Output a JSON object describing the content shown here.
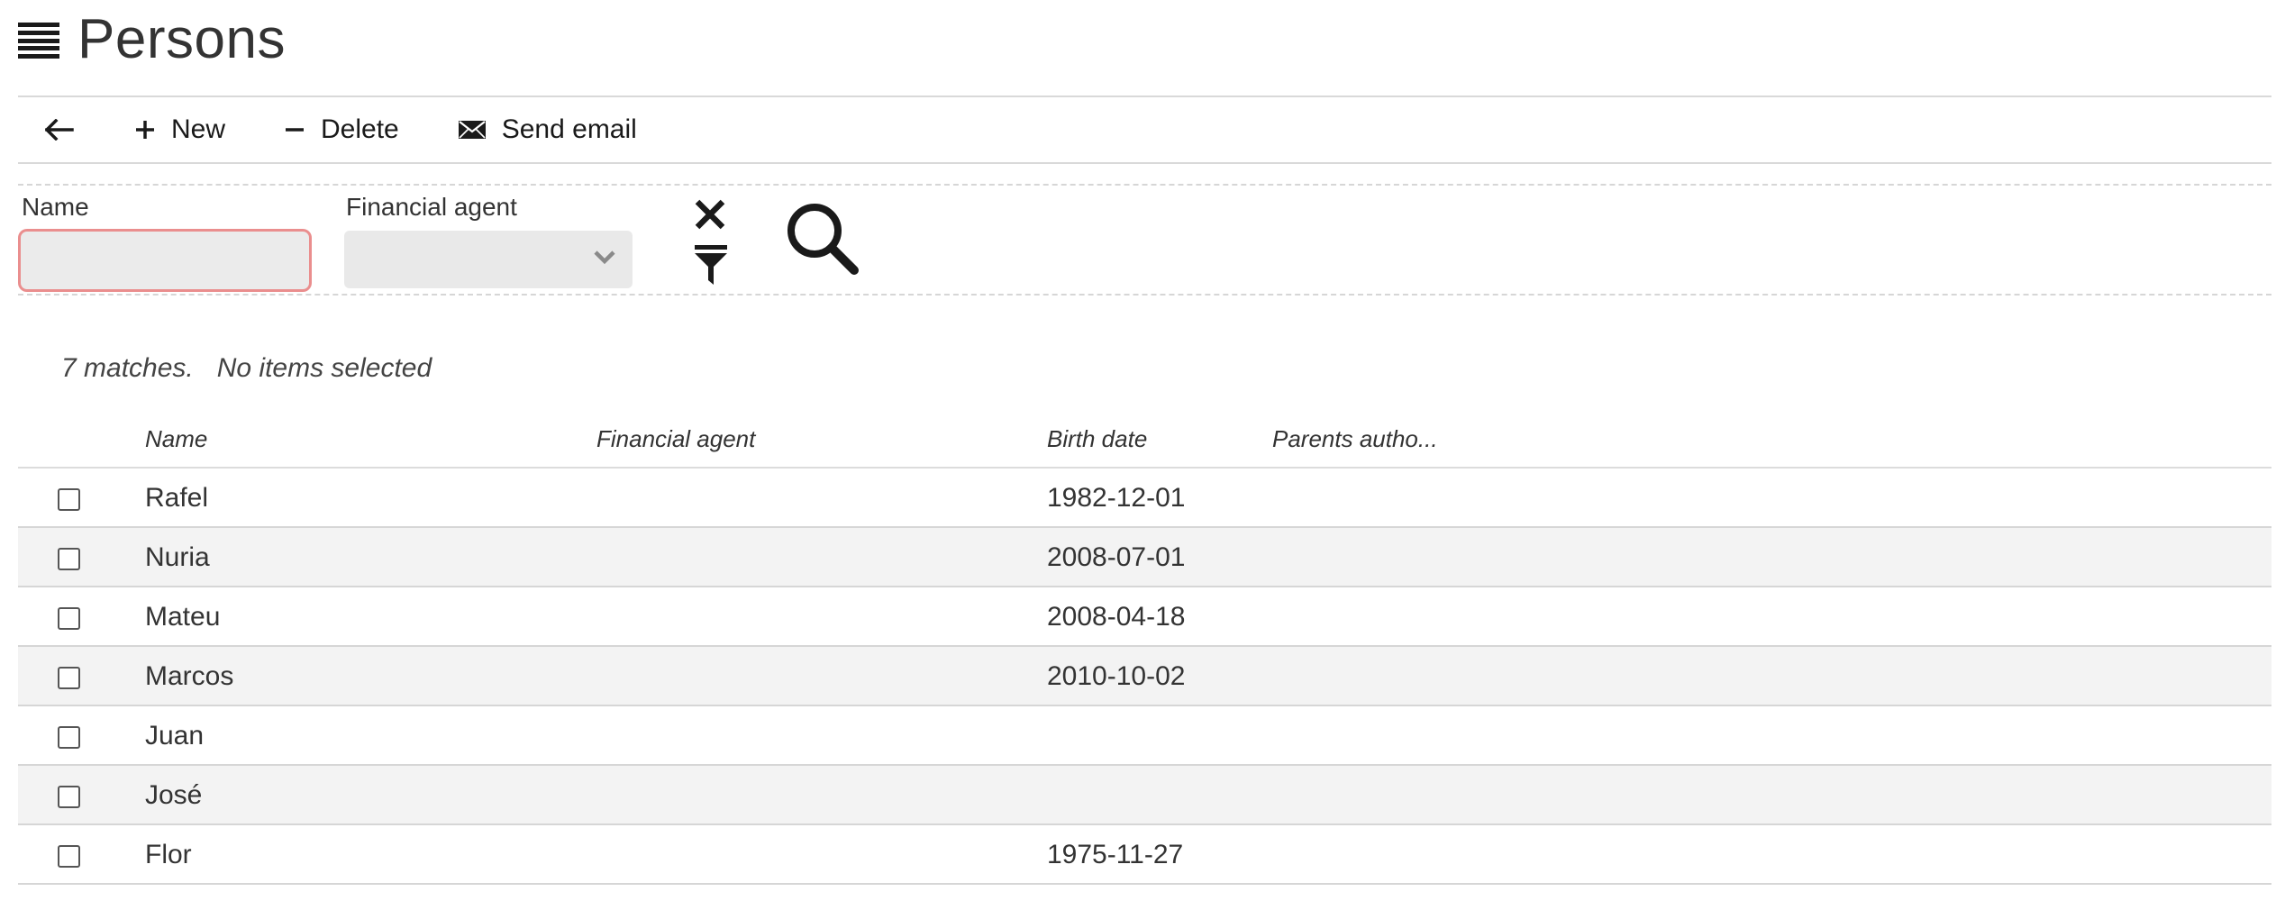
{
  "page": {
    "title": "Persons"
  },
  "toolbar": {
    "new_label": "New",
    "delete_label": "Delete",
    "email_label": "Send email"
  },
  "filter": {
    "name_label": "Name",
    "name_value": "",
    "agent_label": "Financial agent",
    "agent_value": ""
  },
  "summary": {
    "matches": "7 matches.",
    "selection": "No items selected"
  },
  "grid": {
    "columns": [
      "Name",
      "Financial agent",
      "Birth date",
      "Parents autho..."
    ],
    "rows": [
      {
        "name": "Rafel",
        "agent": "",
        "birth": "1982-12-01",
        "parents": ""
      },
      {
        "name": "Nuria",
        "agent": "",
        "birth": "2008-07-01",
        "parents": ""
      },
      {
        "name": "Mateu",
        "agent": "",
        "birth": "2008-04-18",
        "parents": ""
      },
      {
        "name": "Marcos",
        "agent": "",
        "birth": "2010-10-02",
        "parents": ""
      },
      {
        "name": "Juan",
        "agent": "",
        "birth": "",
        "parents": ""
      },
      {
        "name": "José",
        "agent": "",
        "birth": "",
        "parents": ""
      },
      {
        "name": "Flor",
        "agent": "",
        "birth": "1975-11-27",
        "parents": ""
      }
    ]
  },
  "icons": {
    "menu": "hamburger-icon",
    "back": "arrow-left-icon",
    "new": "plus-icon",
    "delete": "minus-icon",
    "email": "envelope-icon",
    "clear": "close-icon",
    "filter": "funnel-icon",
    "search": "search-icon",
    "select": "chevron-down-icon"
  }
}
